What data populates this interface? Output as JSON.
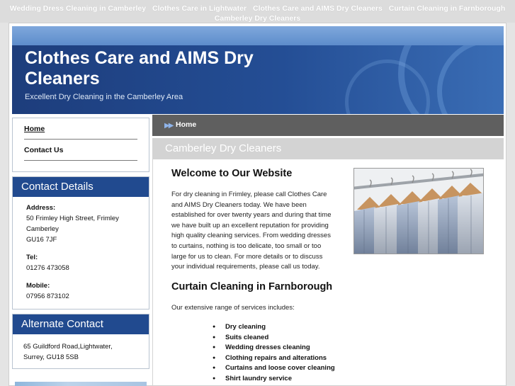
{
  "topnav": {
    "links": [
      "Wedding Dress Cleaning in Camberley",
      "Clothes Care in Lightwater",
      "Clothes Care and AIMS Dry Cleaners",
      "Curtain Cleaning in Farnborough",
      "Camberley Dry Cleaners"
    ]
  },
  "header": {
    "title": "Clothes Care and AIMS Dry Cleaners",
    "tagline": "Excellent Dry Cleaning in the Camberley Area"
  },
  "sidebar": {
    "links": [
      "Home",
      "Contact Us"
    ],
    "contact": {
      "title": "Contact Details",
      "address_label": "Address:",
      "address_lines": [
        "50 Frimley High Street, Frimley",
        "Camberley",
        "GU16 7JF"
      ],
      "tel_label": "Tel:",
      "tel": "01276 473058",
      "mobile_label": "Mobile:",
      "mobile": "07956 873102"
    },
    "alternate": {
      "title": "Alternate Contact",
      "lines": [
        "65 Guildford Road,Lightwater,",
        "Surrey, GU18 5SB"
      ]
    }
  },
  "main": {
    "breadcrumb": "Home",
    "page_heading": "Camberley Dry Cleaners",
    "welcome_heading": "Welcome to Our Website",
    "welcome_lines": [
      "For dry cleaning in Frimley, please call Clothes Care",
      "and AIMS Dry Cleaners today. We have been",
      "established for over twenty years and during that time",
      "we have built up an excellent reputation for providing",
      "high quality cleaning services. From wedding dresses",
      "to curtains, nothing is too delicate, too small or too",
      "large for us to clean. For more details or to discuss",
      "your individual requirements, please call us today."
    ],
    "curtain_heading": "Curtain Cleaning in Farnborough",
    "services_intro": "Our extensive range of services includes:",
    "services": [
      "Dry cleaning",
      "Suits cleaned",
      "Wedding dresses cleaning",
      "Clothing repairs and alterations",
      "Curtains and loose cover cleaning",
      "Shirt laundry service"
    ]
  },
  "colors": {
    "header_blue": "#214a8f",
    "crumb_bar": "#5f5f5f",
    "sub_bar": "#d3d3d3"
  },
  "icons": {
    "breadcrumb_arrows": "double-chevron-right-icon",
    "bullet": "bullet-icon"
  }
}
